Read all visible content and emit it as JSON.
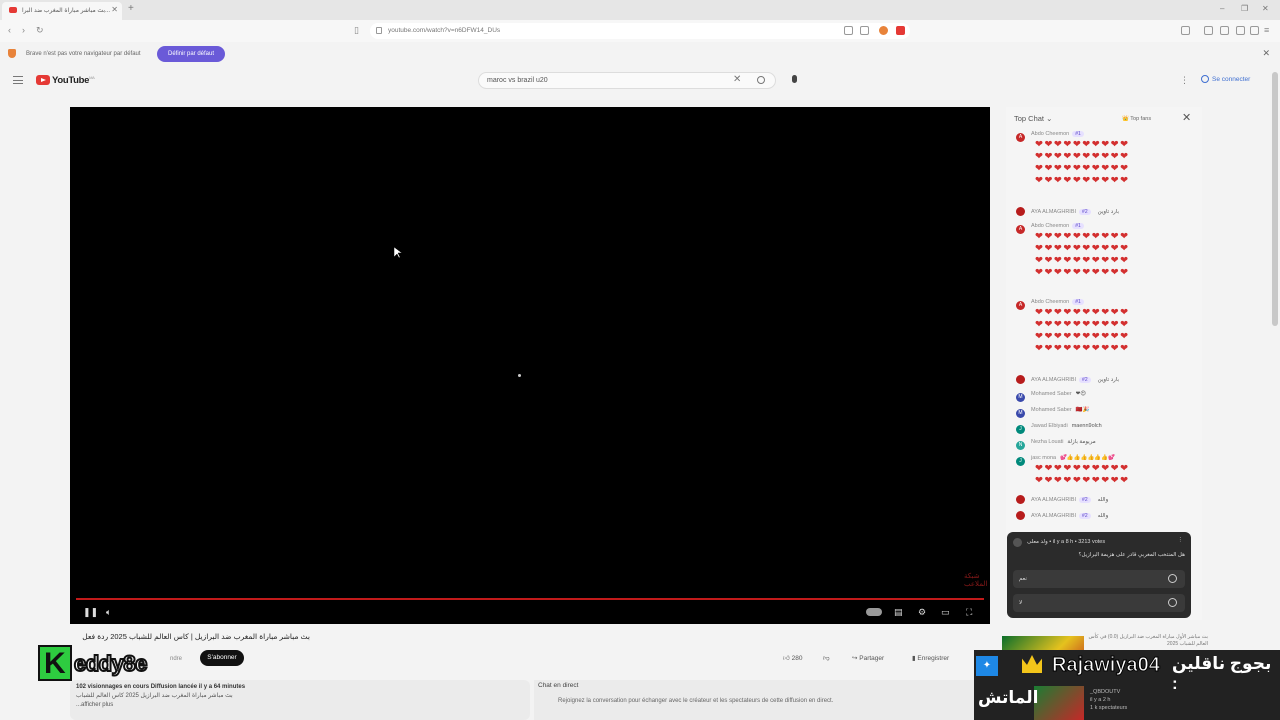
{
  "browser": {
    "tab_title": "بث مباشر مباراة المغرب ضد البرا...",
    "url": "youtube.com/watch?v=n6DFW14_DUs",
    "infobar_message": "Brave n'est pas votre navigateur par défaut",
    "infobar_button": "Définir par défaut"
  },
  "youtube": {
    "logo_text": "YouTube",
    "logo_sup": "MA",
    "search_value": "maroc vs brazil u20",
    "sign_in": "Se connecter"
  },
  "video": {
    "title": "بث مباشر مباراة المغرب ضد البرازيل | كاس العالم للشباب 2025 ردة فعل",
    "channel_overlay": "eddy8e",
    "channel_letter": "K",
    "join_hint": "ndre",
    "subscribe": "S'abonner",
    "likes": "280",
    "share": "Partager",
    "save": "Enregistrer",
    "views_line": "102 visionnages en cours  Diffusion lancée il y a 64 minutes",
    "desc_line1": "بث مباشر مباراة المغرب ضد البرازيل 2025 كاس العالم للشباب",
    "desc_line2": "...afficher plus",
    "watermark": "شبكة الملاعب"
  },
  "live_chat": {
    "header": "Top Chat",
    "top_fans": "Top fans",
    "chat_label": "Chat en direct",
    "chat_hint": "Rejoignez la conversation pour échanger avec le créateur et les spectateurs de cette diffusion en direct.",
    "messages": [
      {
        "author": "Abdo Cheemon",
        "badge": "#1",
        "avatar_color": "#c62828",
        "avatar_letter": "A",
        "text": ""
      },
      {
        "author": "AYA ALMAGHRIBI",
        "badge": "#2",
        "avatar_color": "#b71c1c",
        "avatar_letter": "",
        "text": "بارد تاوين"
      },
      {
        "author": "Abdo Cheemon",
        "badge": "#1",
        "avatar_color": "#c62828",
        "avatar_letter": "A",
        "text": ""
      },
      {
        "author": "Abdo Cheemon",
        "badge": "#1",
        "avatar_color": "#c62828",
        "avatar_letter": "A",
        "text": ""
      },
      {
        "author": "AYA ALMAGHRIBI",
        "badge": "#2",
        "avatar_color": "#b71c1c",
        "avatar_letter": "",
        "text": "بارد تاوين"
      },
      {
        "author": "Mohamed Saber",
        "badge": "",
        "avatar_color": "#3949ab",
        "avatar_letter": "M",
        "text": "❤😍"
      },
      {
        "author": "Mohamed Saber",
        "badge": "",
        "avatar_color": "#3949ab",
        "avatar_letter": "M",
        "text": "🇲🇦🎉"
      },
      {
        "author": "Jawad Elbiyadi",
        "badge": "",
        "avatar_color": "#00897b",
        "avatar_letter": "J",
        "text": "maenn9olch"
      },
      {
        "author": "Nezha Louati",
        "badge": "",
        "avatar_color": "#26a69a",
        "avatar_letter": "N",
        "text": "مريومة بازلة"
      },
      {
        "author": "jasc mona",
        "badge": "",
        "avatar_color": "#00897b",
        "avatar_letter": "J",
        "text": "💕👍👍👍👍👍👍💕"
      },
      {
        "author": "AYA ALMAGHRIBI",
        "badge": "#2",
        "avatar_color": "#b71c1c",
        "avatar_letter": "",
        "text": "والله"
      },
      {
        "author": "AYA ALMAGHRIBI",
        "badge": "#2",
        "avatar_color": "#b71c1c",
        "avatar_letter": "",
        "text": "والله"
      }
    ],
    "hearts_glyph": "❤❤❤❤❤❤❤❤❤❤"
  },
  "poll": {
    "meta": "ولد معلى • il y a 8 h • 3213 votes",
    "question": "هل المنتخب المغربي قادر على هزيمة البرازيل؟",
    "options": [
      "نعم",
      "لا"
    ]
  },
  "stream_overlay": {
    "name": "Rajawiya04",
    "label": "بجوج ناقلين :",
    "bottom": "الماتش"
  },
  "recommendations": {
    "rec1": "بث مباشر الأول مباراة المغرب ضد البرازيل (0.0) في كأس العالم للشباب 2025",
    "rec2_channel": "_QBDOUTV",
    "rec2_meta": "il y a 2 h",
    "rec2_views": "1 k spectateurs"
  },
  "colors": {
    "accent": "#6a5ad8",
    "yt_red": "#e53935",
    "progress": "#c21a1a"
  }
}
